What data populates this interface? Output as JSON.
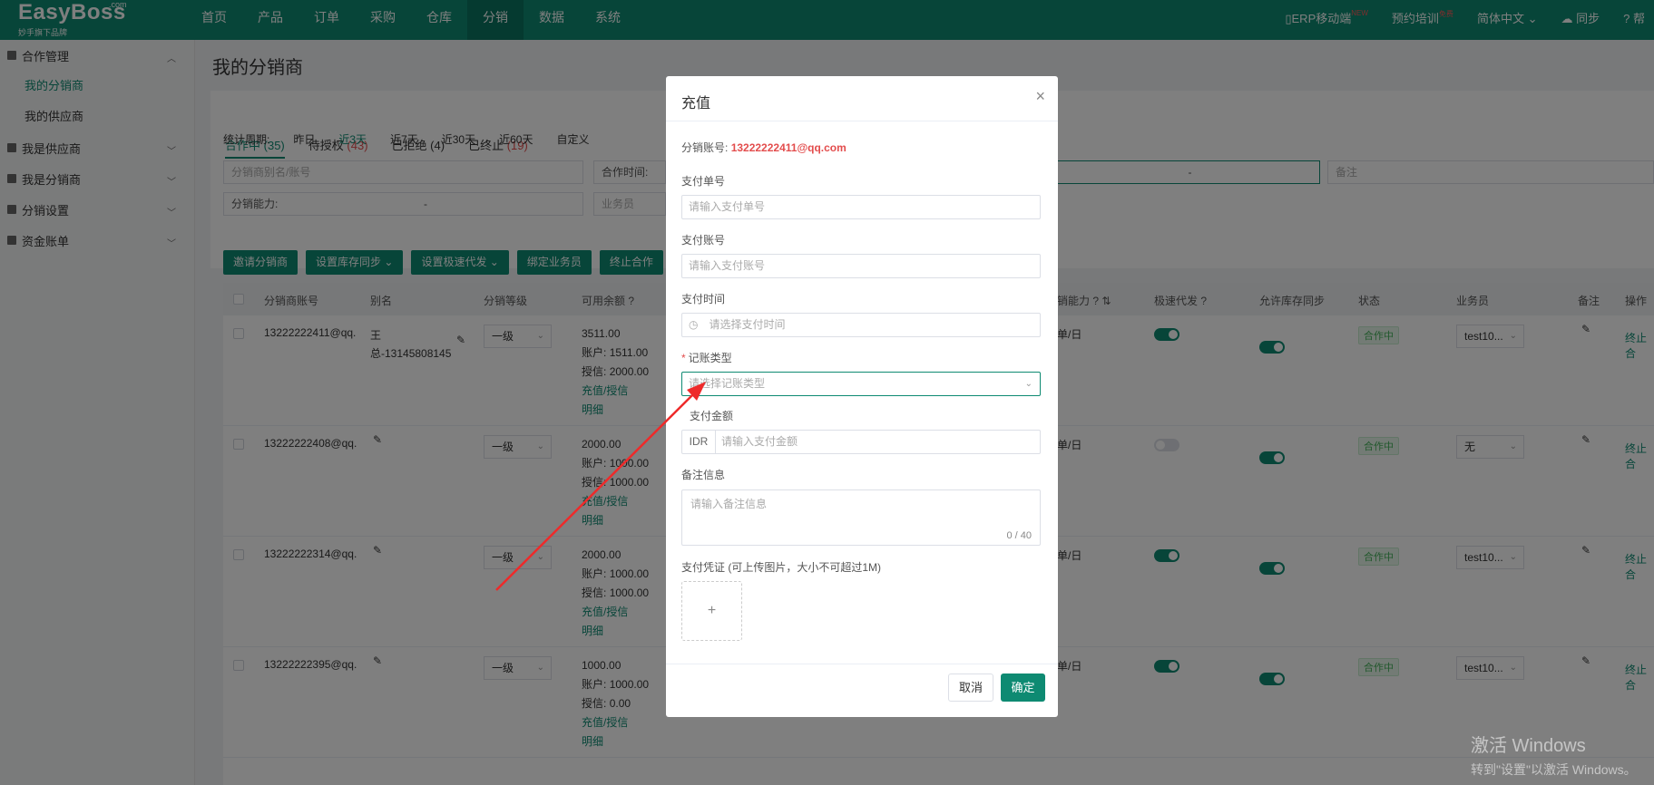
{
  "app": {
    "logo": "EasyBoss",
    "logo_com": ".com",
    "logo_sub": "妙手旗下品牌"
  },
  "nav": {
    "items": [
      "首页",
      "产品",
      "订单",
      "采购",
      "仓库",
      "分销",
      "数据",
      "系统"
    ],
    "right": {
      "erp": "ERP移动端",
      "erp_sup": "NEW",
      "training": "预约培训",
      "training_sup": "免费",
      "language": "简体中文",
      "sync": "同步",
      "help": "帮"
    }
  },
  "sidebar": {
    "groups": [
      {
        "label": "合作管理"
      },
      {
        "label": "我是供应商"
      },
      {
        "label": "我是分销商"
      },
      {
        "label": "分销设置"
      },
      {
        "label": "资金账单"
      }
    ],
    "sub_items": [
      "我的分销商",
      "我的供应商"
    ]
  },
  "main": {
    "title": "我的分销商",
    "tabs": [
      {
        "label": "合作中",
        "count": "(35)"
      },
      {
        "label": "待授权",
        "count": "(43)"
      },
      {
        "label": "已拒绝",
        "count": "(4)"
      },
      {
        "label": "已终止",
        "count": "(19)"
      }
    ],
    "period_label": "统计周期:",
    "periods": [
      "昨日",
      "近3天",
      "近7天",
      "近30天",
      "近60天",
      "自定义"
    ],
    "filters": {
      "search_placeholder": "分销商别名/账号",
      "coop_time": "合作时间:",
      "ability": "分销能力:",
      "ability_dash": "-",
      "salesman": "业务员",
      "range_dash": "-",
      "remark": "备注"
    },
    "buttons": [
      "邀请分销商",
      "设置库存同步",
      "设置极速代发",
      "绑定业务员",
      "终止合作"
    ],
    "table": {
      "headers": {
        "account": "分销商账号",
        "alias": "别名",
        "level": "分销等级",
        "balance": "可用余额",
        "ability": "销能力",
        "fast": "极速代发",
        "stock": "允许库存同步",
        "status": "状态",
        "salesman": "业务员",
        "remark": "备注",
        "ops": "操作"
      },
      "rows": [
        {
          "account": "13222222411@qq.",
          "alias": "王",
          "alias2": "总-13145808145",
          "level": "一级",
          "available": "3511.00",
          "acct_label": "账户:",
          "acct": "1511.00",
          "credit_label": "授信:",
          "credit": "2000.00",
          "recharge": "充值/授信",
          "detail": "明细",
          "ability": "单/日",
          "status": "合作中",
          "salesman": "test10...",
          "op": "终止合"
        },
        {
          "account": "13222222408@qq.",
          "alias": "",
          "alias2": "",
          "level": "一级",
          "available": "2000.00",
          "acct_label": "账户:",
          "acct": "1000.00",
          "credit_label": "授信:",
          "credit": "1000.00",
          "recharge": "充值/授信",
          "detail": "明细",
          "ability": "单/日",
          "status": "合作中",
          "salesman": "无",
          "op": "终止合"
        },
        {
          "account": "13222222314@qq.",
          "alias": "",
          "alias2": "",
          "level": "一级",
          "available": "2000.00",
          "acct_label": "账户:",
          "acct": "1000.00",
          "credit_label": "授信:",
          "credit": "1000.00",
          "recharge": "充值/授信",
          "detail": "明细",
          "ability": "单/日",
          "status": "合作中",
          "salesman": "test10...",
          "op": "终止合"
        },
        {
          "account": "13222222395@qq.",
          "alias": "",
          "alias2": "",
          "level": "一级",
          "available": "1000.00",
          "acct_label": "账户:",
          "acct": "1000.00",
          "credit_label": "授信:",
          "credit": "0.00",
          "recharge": "充值/授信",
          "detail": "明细",
          "ability": "单/日",
          "status": "合作中",
          "salesman": "test10...",
          "op": "终止合"
        }
      ]
    }
  },
  "modal": {
    "title": "充值",
    "account_label": "分销账号:",
    "account_value": "13222222411@qq.com",
    "pay_no_label": "支付单号",
    "pay_no_placeholder": "请输入支付单号",
    "pay_account_label": "支付账号",
    "pay_account_placeholder": "请输入支付账号",
    "pay_time_label": "支付时间",
    "pay_time_placeholder": "请选择支付时间",
    "type_label": "记账类型",
    "type_placeholder": "请选择记账类型",
    "amount_label": "支付金额",
    "amount_prefix": "IDR",
    "amount_placeholder": "请输入支付金额",
    "remark_label": "备注信息",
    "remark_placeholder": "请输入备注信息",
    "remark_count": "0 / 40",
    "voucher_label": "支付凭证",
    "voucher_hint": "(可上传图片，大小不可超过1M)",
    "cancel": "取消",
    "confirm": "确定"
  },
  "watermark": {
    "line1": "激活 Windows",
    "line2": "转到\"设置\"以激活 Windows。"
  },
  "colors": {
    "brand": "#0e8a72",
    "danger": "#e34d4d",
    "arrow": "#ee2a2a"
  }
}
